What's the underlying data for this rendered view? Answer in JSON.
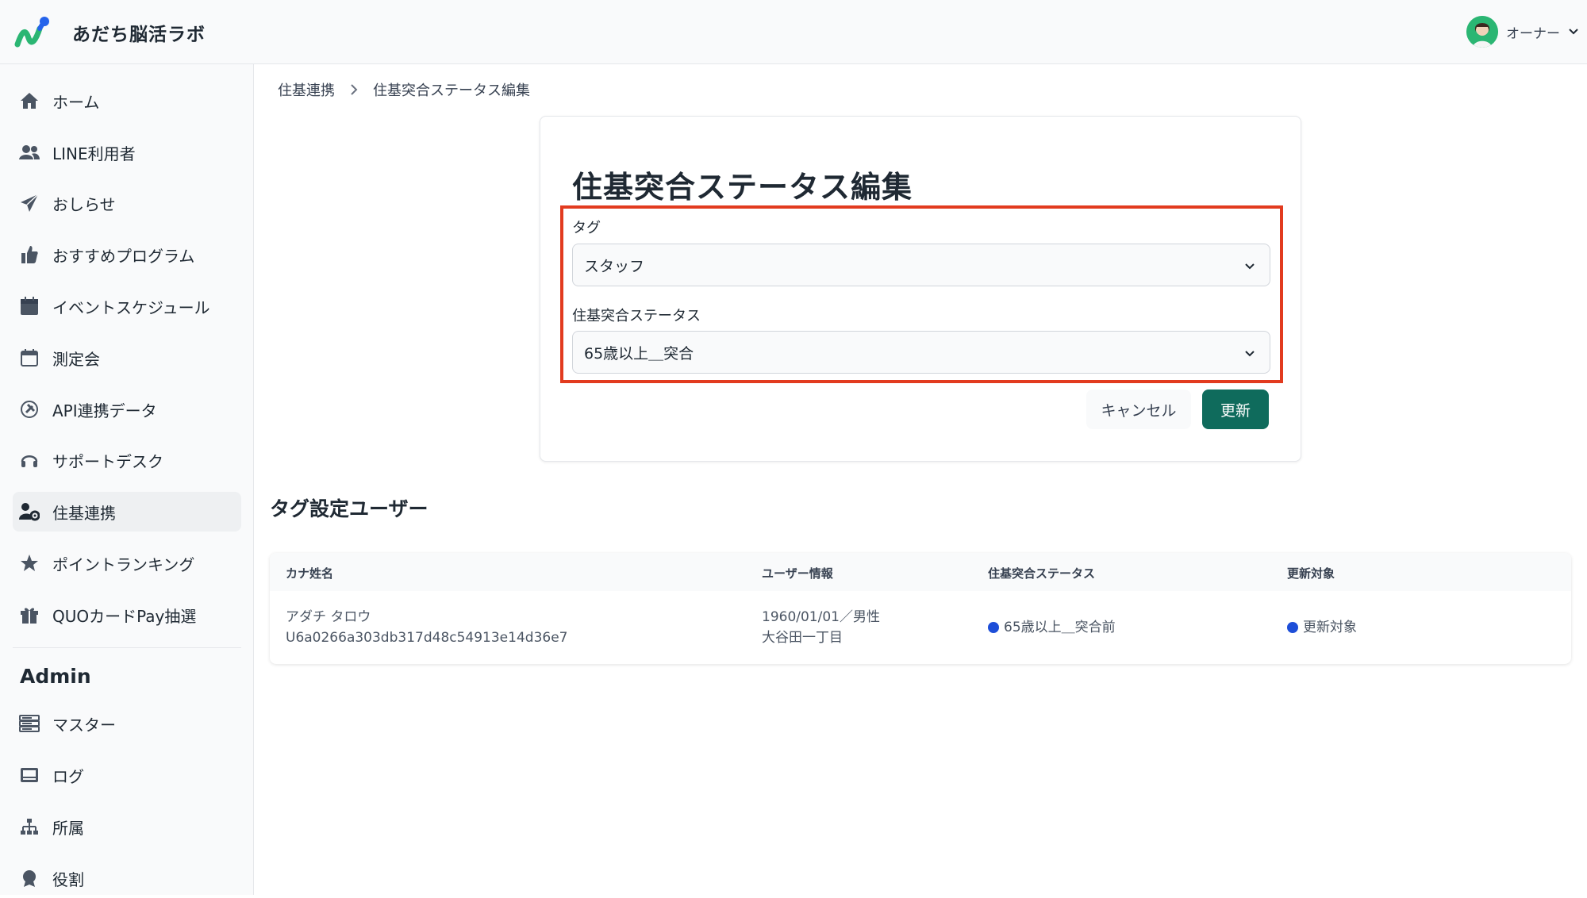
{
  "app": {
    "title": "あだち脳活ラボ"
  },
  "user_menu": {
    "name": "オーナー"
  },
  "sidebar": {
    "items": [
      {
        "label": "ホーム",
        "icon": "home-icon"
      },
      {
        "label": "LINE利用者",
        "icon": "users-icon"
      },
      {
        "label": "おしらせ",
        "icon": "paper-plane-icon"
      },
      {
        "label": "おすすめプログラム",
        "icon": "thumbs-up-icon"
      },
      {
        "label": "イベントスケジュール",
        "icon": "calendar-icon"
      },
      {
        "label": "測定会",
        "icon": "calendar-blank-icon"
      },
      {
        "label": "API連携データ",
        "icon": "plug-icon"
      },
      {
        "label": "サポートデスク",
        "icon": "headset-icon"
      },
      {
        "label": "住基連携",
        "icon": "user-gear-icon",
        "active": true
      },
      {
        "label": "ポイントランキング",
        "icon": "star-icon"
      },
      {
        "label": "QUOカードPay抽選",
        "icon": "gift-icon"
      }
    ],
    "admin_title": "Admin",
    "admin_items": [
      {
        "label": "マスター",
        "icon": "server-icon"
      },
      {
        "label": "ログ",
        "icon": "log-icon"
      },
      {
        "label": "所属",
        "icon": "sitemap-icon"
      },
      {
        "label": "役割",
        "icon": "award-icon"
      }
    ]
  },
  "breadcrumb": {
    "parent": "住基連携",
    "current": "住基突合ステータス編集"
  },
  "form": {
    "title": "住基突合ステータス編集",
    "tag_label": "タグ",
    "tag_value": "スタッフ",
    "status_label": "住基突合ステータス",
    "status_value": "65歳以上＿突合",
    "cancel_label": "キャンセル",
    "update_label": "更新"
  },
  "section": {
    "title": "タグ設定ユーザー"
  },
  "table": {
    "headers": [
      "カナ姓名",
      "ユーザー情報",
      "住基突合ステータス",
      "更新対象"
    ],
    "rows": [
      {
        "kana": "アダチ タロウ",
        "line_id": "U6a0266a303db317d48c54913e14d36e7",
        "info_line1": "1960/01/01／男性",
        "info_line2": "大谷田一丁目",
        "status": "65歳以上＿突合前",
        "update_target": "更新対象"
      }
    ]
  },
  "colors": {
    "accent": "#0f6b5c",
    "highlight": "#e23b1f",
    "status_dot": "#1d4ed8",
    "logo_green": "#2bb673",
    "logo_blue": "#2563eb"
  }
}
